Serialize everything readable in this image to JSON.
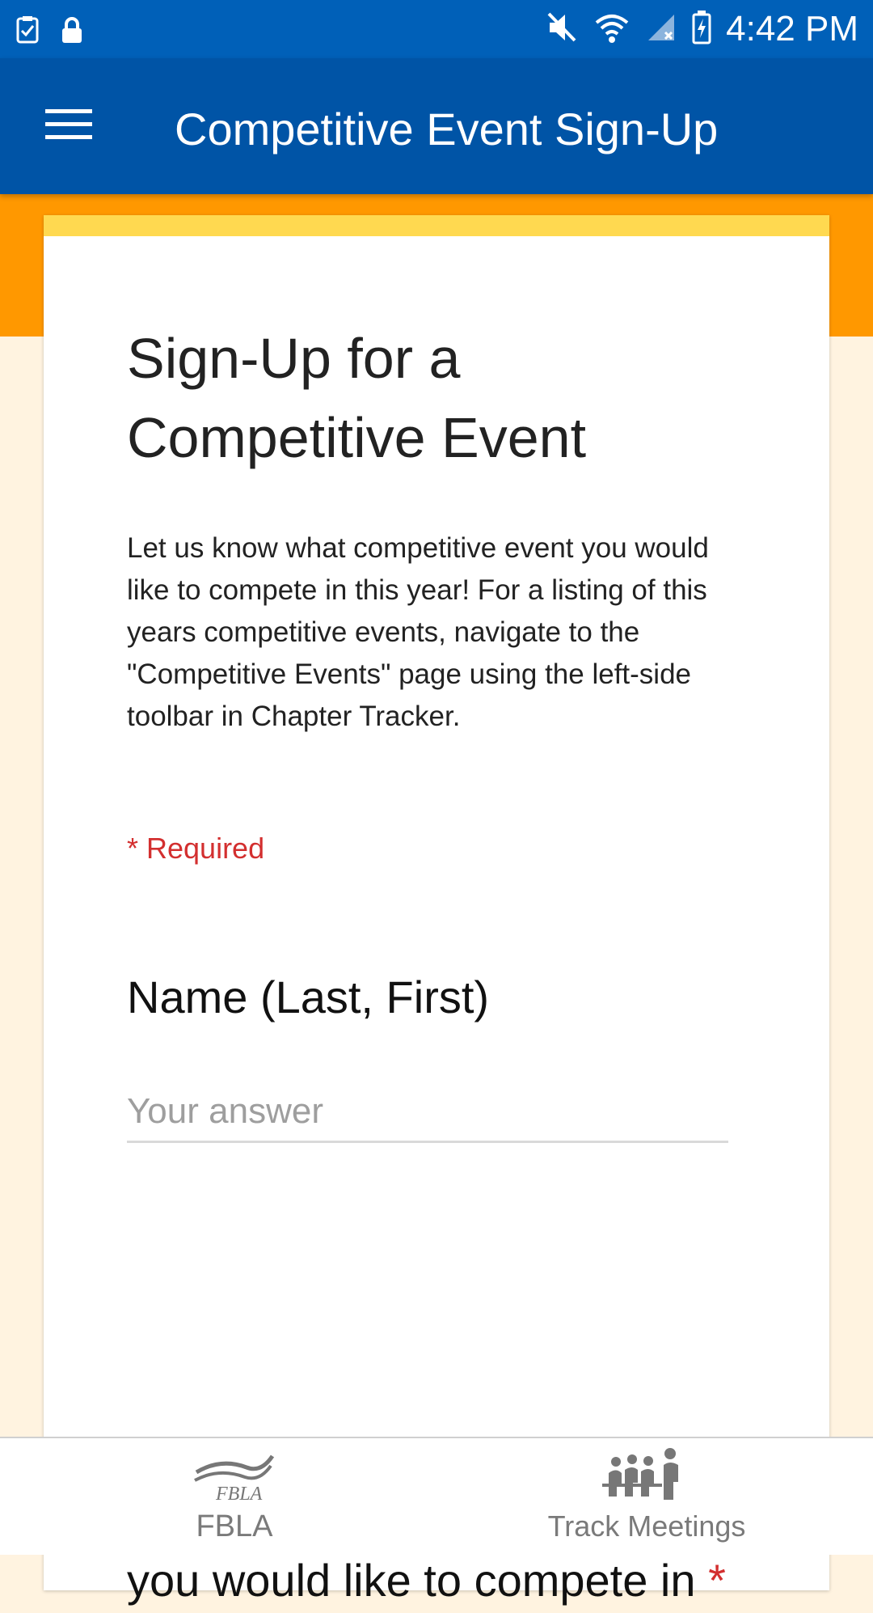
{
  "status_bar": {
    "time": "4:42 PM",
    "icons": [
      "task-check-icon",
      "lock-icon",
      "mute-icon",
      "wifi-icon",
      "signal-icon",
      "battery-icon"
    ]
  },
  "app_bar": {
    "title": "Competitive Event Sign-Up",
    "menu_icon": "hamburger-menu-icon"
  },
  "form": {
    "title": "Sign-Up for a Competitive Event",
    "description": "Let us know what competitive event you would like to compete in this year! For a listing of this years competitive events, navigate to the \"Competitive Events\" page using the left-side toolbar in Chapter Tracker.",
    "required_note": "* Required",
    "questions": [
      {
        "label": "Name (Last, First)",
        "placeholder": "Your answer",
        "value": ""
      },
      {
        "label": "Name of the competitive event you would like to compete in",
        "required_mark": "*"
      }
    ]
  },
  "bottom_nav": {
    "items": [
      {
        "label": "FBLA",
        "icon_text": "FBLA",
        "icon": "fbla-logo-icon"
      },
      {
        "label": "Track Meetings",
        "icon": "meeting-people-icon"
      }
    ]
  },
  "colors": {
    "status_bar": "#0060b8",
    "app_bar": "#0054a6",
    "orange_band": "#ff9800",
    "page_background": "#fff3e0",
    "card_accent": "#ffd950",
    "required": "#d32f2f"
  }
}
